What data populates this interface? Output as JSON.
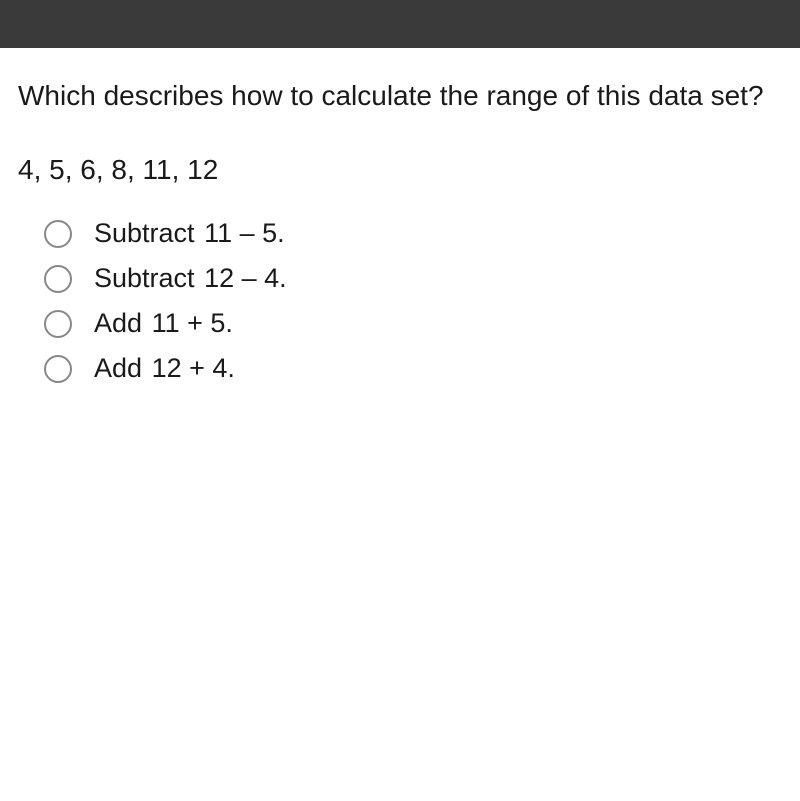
{
  "question": "Which describes how to calculate the range of this data set?",
  "dataset": "4, 5, 6, 8, 11, 12",
  "options": [
    {
      "verb": "Subtract",
      "expr": "11 – 5."
    },
    {
      "verb": "Subtract",
      "expr": "12 – 4."
    },
    {
      "verb": "Add",
      "expr": "11 + 5."
    },
    {
      "verb": "Add",
      "expr": "12 + 4."
    }
  ]
}
